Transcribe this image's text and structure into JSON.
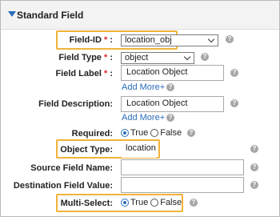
{
  "header": {
    "title": "Standard Field"
  },
  "fields": {
    "field_id": {
      "label": "Field-ID",
      "required_mark": "*",
      "value": "location_obj"
    },
    "field_type": {
      "label": "Field Type",
      "required_mark": "*",
      "value": "object"
    },
    "field_label": {
      "label": "Field Label",
      "required_mark": "*",
      "value": "Location Object",
      "add_more": "Add More+"
    },
    "field_description": {
      "label": "Field Description:",
      "value": "Location Object",
      "add_more": "Add More+"
    },
    "required": {
      "label": "Required:",
      "options": [
        "True",
        "False"
      ],
      "selected": "True"
    },
    "object_type": {
      "label": "Object Type:",
      "value": "location"
    },
    "source_field_name": {
      "label": "Source Field Name:",
      "value": ""
    },
    "destination_field_value": {
      "label": "Destination Field Value:",
      "value": ""
    },
    "multi_select": {
      "label": "Multi-Select:",
      "options": [
        "True",
        "False"
      ],
      "selected": "True"
    }
  },
  "colon": ":",
  "help_glyph": "?",
  "colors": {
    "accent": "#2a6ebb",
    "highlight": "#f2b33a",
    "required": "#e0282e"
  }
}
